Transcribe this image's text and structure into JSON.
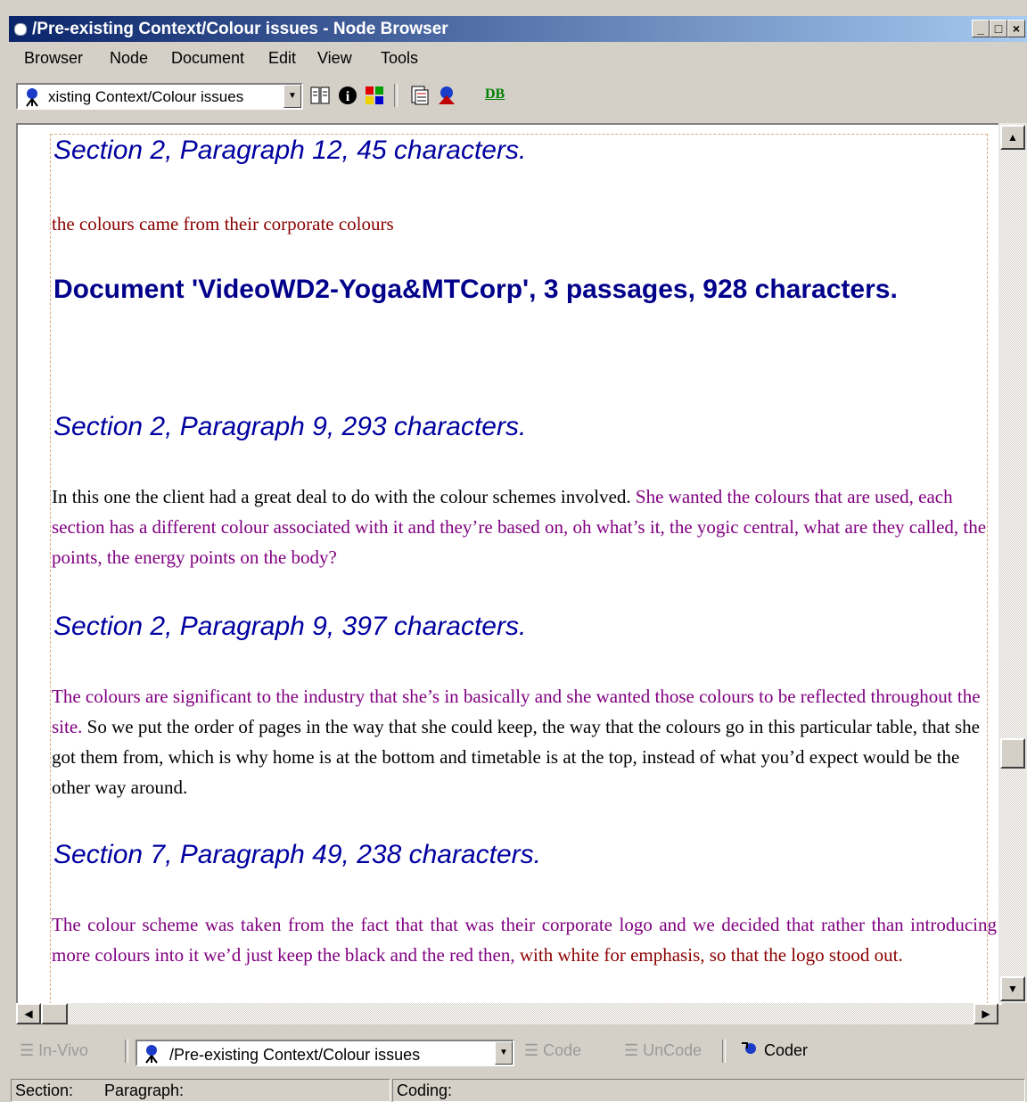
{
  "window": {
    "title": "/Pre-existing Context/Colour issues - Node Browser",
    "controls": [
      "_",
      "□",
      "×"
    ]
  },
  "menu": [
    "Browser",
    "Node",
    "Document",
    "Edit",
    "View",
    "Tools"
  ],
  "toolbar": {
    "node_path": "xisting Context/Colour issues",
    "db_label": "DB"
  },
  "content": {
    "h1": "Section 2, Paragraph 12, 45 characters.",
    "p1": "the colours came from their corporate colours",
    "doc_heading": "Document 'VideoWD2-Yoga&MTCorp',  3 passages, 928 characters.",
    "h2": "Section 2, Paragraph 9, 293 characters.",
    "p2_black": "In this one the client had a great deal to do with the colour schemes involved.  ",
    "p2_purple": "She wanted the colours that are used, each section has a different colour associated with it and they’re based on, oh what’s it, the yogic central, what are they called, the points, the energy points on the body?",
    "h3": "Section 2, Paragraph 9, 397 characters.",
    "p3_purple": "The colours are significant to the industry that she’s in basically and she wanted those colours to be reflected throughout the site.",
    "p3_black": "  So we put the order of pages in the way that she could keep, the way that the colours go in this particular table, that she got them from, which is why home is at the bottom and timetable is at the top, instead of what you’d expect would be the other way around.",
    "h4": "Section 7, Paragraph 49, 238 characters.",
    "p4_purple": "The colour scheme was taken from the fact that that was their corporate logo and we decided that rather than introducing more colours into it we’d just keep the black and the red then, ",
    "p4_red": "with white for emphasis, so that the logo stood out."
  },
  "bottombar": {
    "invivo": "In-Vivo",
    "node_path": "/Pre-existing Context/Colour issues",
    "code": "Code",
    "uncode": "UnCode",
    "coder": "Coder"
  },
  "status": {
    "section": "Section:",
    "paragraph": "Paragraph:",
    "coding": "Coding:"
  }
}
